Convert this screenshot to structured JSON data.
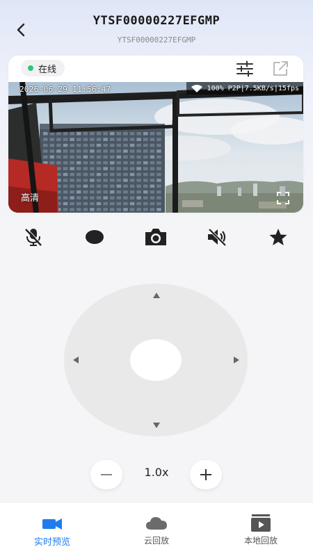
{
  "header": {
    "title": "YTSF00000227EFGMP",
    "subtitle": "YTSF00000227EFGMP"
  },
  "card": {
    "status_label": "在线",
    "status_color": "#2dc77a",
    "icons": [
      "settings-sliders-icon",
      "share-external-icon"
    ]
  },
  "video": {
    "timestamp": "2026-06-29 11:56:47",
    "network_stats": "100% P2P|7.5KB/s|15fps",
    "quality_label": "高清"
  },
  "controls": {
    "icons": [
      "mic-off-icon",
      "record-icon",
      "camera-icon",
      "speaker-off-icon",
      "favorite-star-icon"
    ]
  },
  "ptz": {
    "icons": [
      "arrow-up-icon",
      "arrow-down-icon",
      "arrow-left-icon",
      "arrow-right-icon"
    ]
  },
  "zoom": {
    "value": "1.0x"
  },
  "bottom_nav": {
    "items": [
      {
        "label": "实时预览",
        "icon": "video-camera-icon",
        "active": true
      },
      {
        "label": "云回放",
        "icon": "cloud-icon",
        "active": false
      },
      {
        "label": "本地回放",
        "icon": "playlist-play-icon",
        "active": false
      }
    ],
    "active_color": "#1f7cf0"
  }
}
